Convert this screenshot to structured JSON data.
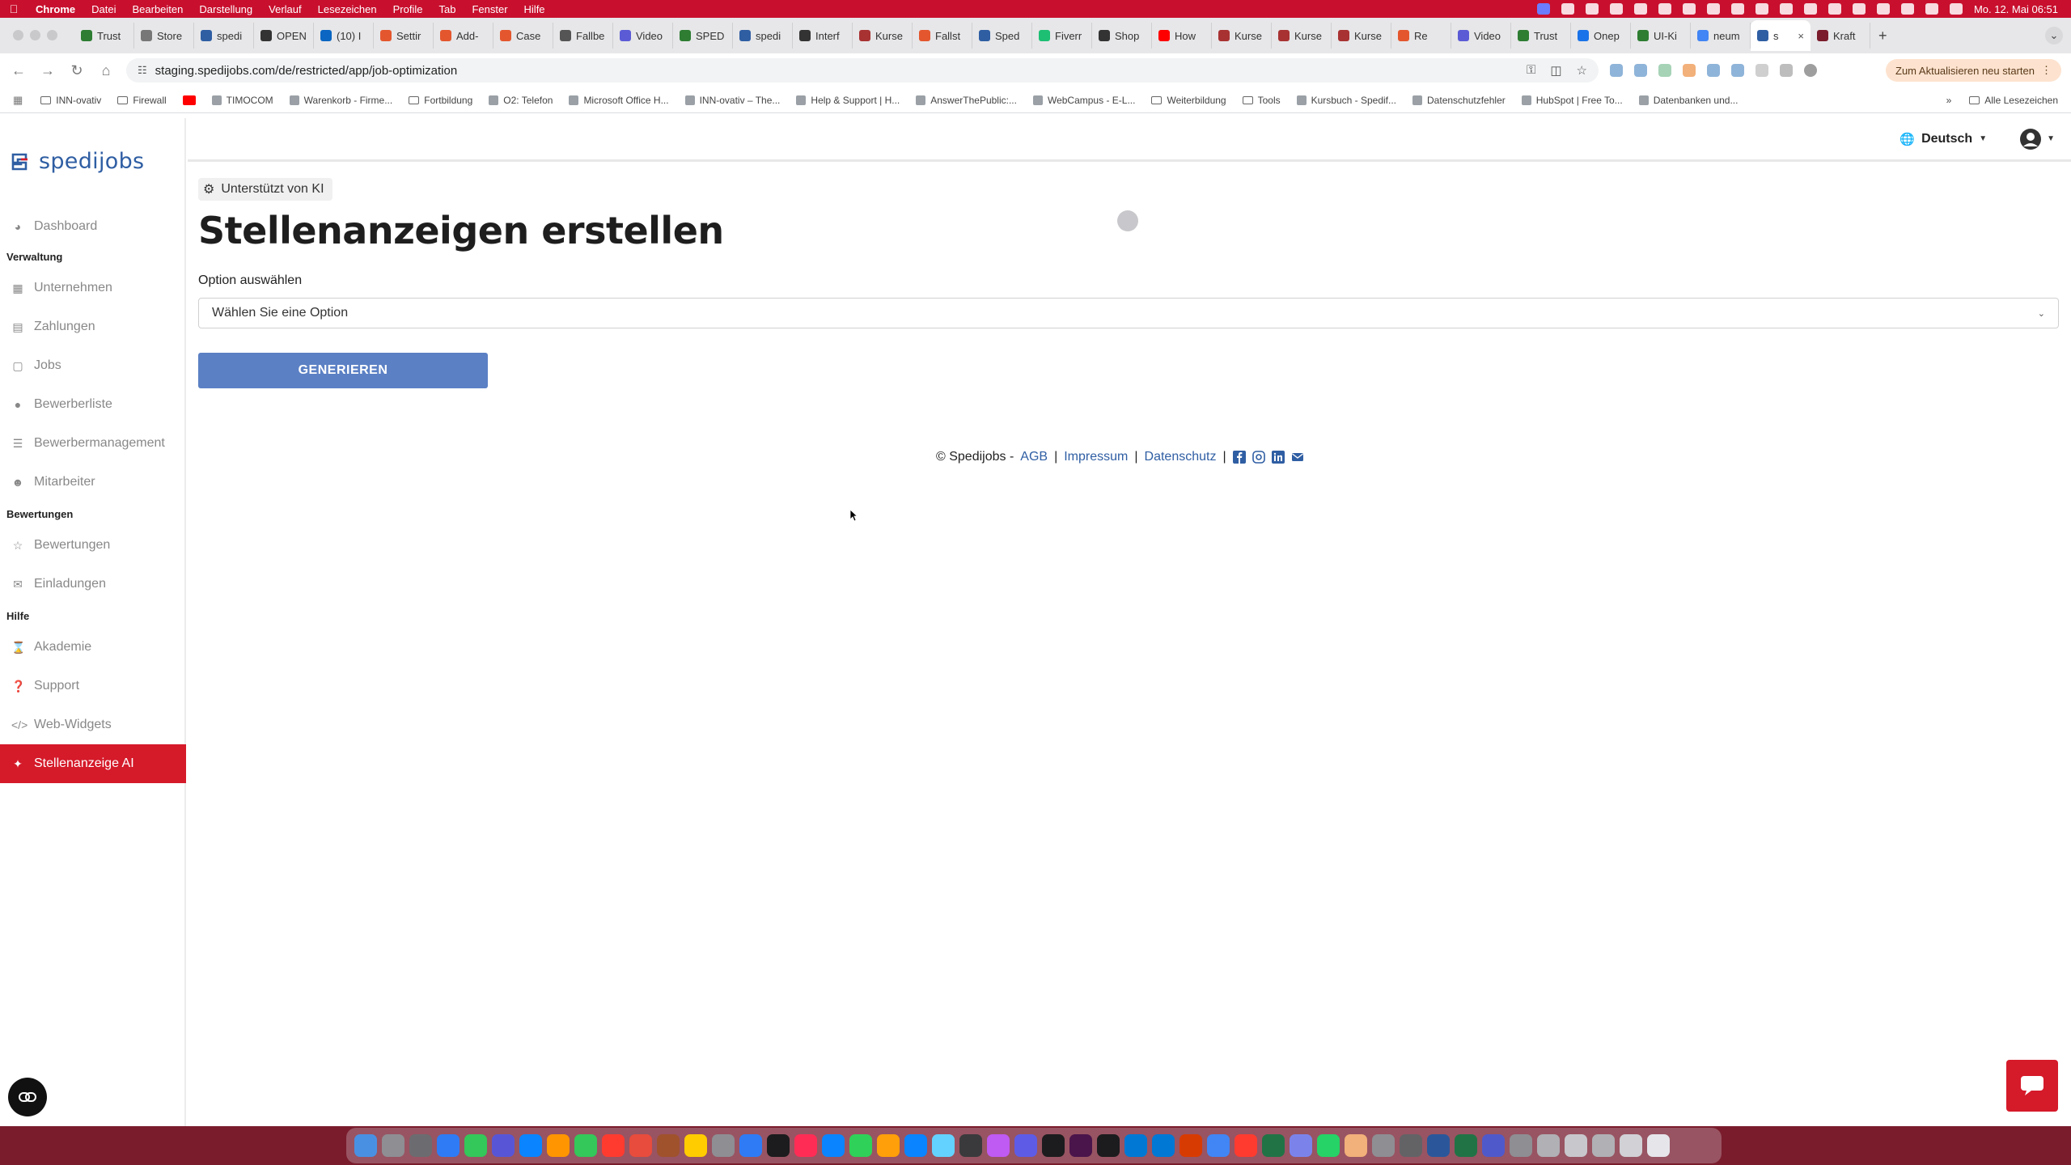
{
  "mac_menu": {
    "app": "Chrome",
    "items": [
      "Datei",
      "Bearbeiten",
      "Darstellung",
      "Verlauf",
      "Lesezeichen",
      "Profile",
      "Tab",
      "Fenster",
      "Hilfe"
    ],
    "clock": "Mo. 12. Mai  06:51"
  },
  "tabs": [
    {
      "label": "Trust",
      "color": "#2e7d32"
    },
    {
      "label": "Store",
      "color": "#777777"
    },
    {
      "label": "spedi",
      "color": "#2f5ea3"
    },
    {
      "label": "OPEN",
      "color": "#333333"
    },
    {
      "label": "(10) I",
      "color": "#0a66c2"
    },
    {
      "label": "Settir",
      "color": "#e4572e"
    },
    {
      "label": "Add-",
      "color": "#e4572e"
    },
    {
      "label": "Case",
      "color": "#e4572e"
    },
    {
      "label": "Fallbe",
      "color": "#555555"
    },
    {
      "label": "Video",
      "color": "#5b5bd6"
    },
    {
      "label": "SPED",
      "color": "#2e7d32"
    },
    {
      "label": "spedi",
      "color": "#2f5ea3"
    },
    {
      "label": "Interf",
      "color": "#333333"
    },
    {
      "label": "Kurse",
      "color": "#a83232"
    },
    {
      "label": "Fallst",
      "color": "#e4572e"
    },
    {
      "label": "Sped",
      "color": "#2f5ea3"
    },
    {
      "label": "Fiverr",
      "color": "#1dbf73"
    },
    {
      "label": "Shop",
      "color": "#333333"
    },
    {
      "label": "How",
      "color": "#ff0000"
    },
    {
      "label": "Kurse",
      "color": "#a83232"
    },
    {
      "label": "Kurse",
      "color": "#a83232"
    },
    {
      "label": "Kurse",
      "color": "#a83232"
    },
    {
      "label": "Re",
      "color": "#e4572e"
    },
    {
      "label": "Video",
      "color": "#5b5bd6"
    },
    {
      "label": "Trust",
      "color": "#2e7d32"
    },
    {
      "label": "Onep",
      "color": "#1a73e8"
    },
    {
      "label": "UI-Ki",
      "color": "#2e7d32"
    },
    {
      "label": "neum",
      "color": "#4285f4"
    },
    {
      "label": "s",
      "color": "#2f5ea3",
      "active": true
    },
    {
      "label": "Kraft",
      "color": "#7a1c2c"
    }
  ],
  "toolbar": {
    "url": "staging.spedijobs.com/de/restricted/app/job-optimization",
    "update_label": "Zum Aktualisieren neu starten"
  },
  "bookmarks": [
    {
      "label": "INN-ovativ",
      "kind": "folder"
    },
    {
      "label": "Firewall",
      "kind": "folder"
    },
    {
      "label": "",
      "kind": "youtube"
    },
    {
      "label": "TIMOCOM",
      "kind": "site"
    },
    {
      "label": "Warenkorb - Firme...",
      "kind": "site"
    },
    {
      "label": "Fortbildung",
      "kind": "folder"
    },
    {
      "label": "O2: Telefon",
      "kind": "site"
    },
    {
      "label": "Microsoft Office H...",
      "kind": "site"
    },
    {
      "label": "INN-ovativ – The...",
      "kind": "site"
    },
    {
      "label": "Help & Support | H...",
      "kind": "site"
    },
    {
      "label": "AnswerThePublic:...",
      "kind": "site"
    },
    {
      "label": "WebCampus - E-L...",
      "kind": "site"
    },
    {
      "label": "Weiterbildung",
      "kind": "folder"
    },
    {
      "label": "Tools",
      "kind": "folder"
    },
    {
      "label": "Kursbuch - Spedif...",
      "kind": "site"
    },
    {
      "label": "Datenschutzfehler",
      "kind": "site"
    },
    {
      "label": "HubSpot | Free To...",
      "kind": "site"
    },
    {
      "label": "Datenbanken und...",
      "kind": "site"
    }
  ],
  "bookmarks_all": "Alle Lesezeichen",
  "brand": {
    "name": "spedijobs",
    "color": "#2f5ea3"
  },
  "sidebar": {
    "dashboard": "Dashboard",
    "section_verwaltung": "Verwaltung",
    "unternehmen": "Unternehmen",
    "zahlungen": "Zahlungen",
    "jobs": "Jobs",
    "bewerberliste": "Bewerberliste",
    "bewerbermanagement": "Bewerbermanagement",
    "mitarbeiter": "Mitarbeiter",
    "section_bewertungen": "Bewertungen",
    "bewertungen": "Bewertungen",
    "einladungen": "Einladungen",
    "section_hilfe": "Hilfe",
    "akademie": "Akademie",
    "support": "Support",
    "web_widgets": "Web-Widgets",
    "stellenanzeige_ai": "Stellenanzeige AI",
    "active_color": "#d51a2a"
  },
  "header": {
    "language": "Deutsch"
  },
  "main": {
    "badge": "Unterstützt von KI",
    "title": "Stellenanzeigen erstellen",
    "option_label": "Option auswählen",
    "select_value": "Wählen Sie eine Option",
    "generate_label": "GENERIEREN",
    "button_color": "#5b80c4"
  },
  "footer": {
    "copyright": "© Spedijobs -",
    "agb": "AGB",
    "sep": "|",
    "impressum": "Impressum",
    "datenschutz": "Datenschutz"
  }
}
